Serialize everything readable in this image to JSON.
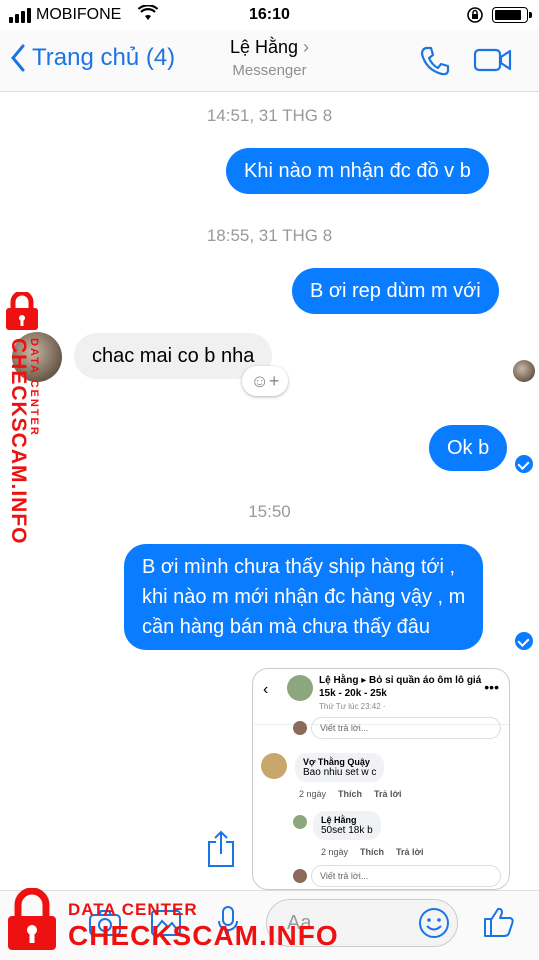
{
  "status_bar": {
    "carrier": "MOBIFONE",
    "time": "16:10"
  },
  "nav": {
    "back_label": "Trang chủ (4)",
    "contact_name": "Lệ Hằng",
    "subtitle": "Messenger"
  },
  "colors": {
    "accent": "#0a7cff",
    "incoming": "#f1f0f0",
    "watermark": "#e11111"
  },
  "messages": {
    "ts1": "14:51, 31 THG 8",
    "m1": "Khi nào m nhận đc đồ v b",
    "ts2": "18:55, 31 THG 8",
    "m2": "B ơi rep dùm m với",
    "m3": "chac mai co b nha",
    "m4": "Ok b",
    "ts3": "15:50",
    "m5_l1": "B ơi mình chưa thấy ship hàng tới ,",
    "m5_l2": "khi nào m mới nhận đc hàng vậy , m",
    "m5_l3": "cần hàng bán mà chưa thấy đâu"
  },
  "screenshot": {
    "name": "Lệ Hằng",
    "post_title": "Bỏ sỉ quần áo ôm lô giá",
    "prices": "15k - 20k - 25k",
    "time": "Thứ Tư lúc 23:42 · ",
    "reply_ph": "Viết trả lời...",
    "c1_name": "Vợ Thằng Quậy",
    "c1_text": "Bao nhiu set w c",
    "c1_age": "2 ngày",
    "like": "Thích",
    "reply": "Trả lời",
    "c2_name": "Lệ Hằng",
    "c2_text": "50set 18k b",
    "c2_age": "2 ngày"
  },
  "compose": {
    "placeholder": "Aa"
  },
  "watermark": {
    "line1": "DATA CENTER",
    "line2": "CHECKSCAM.INFO"
  },
  "icons": [
    "back-chevron-icon",
    "phone-icon",
    "video-icon",
    "camera-icon",
    "gallery-icon",
    "mic-icon",
    "emoji-icon",
    "thumbs-up-icon",
    "share-icon",
    "lock-icon"
  ]
}
